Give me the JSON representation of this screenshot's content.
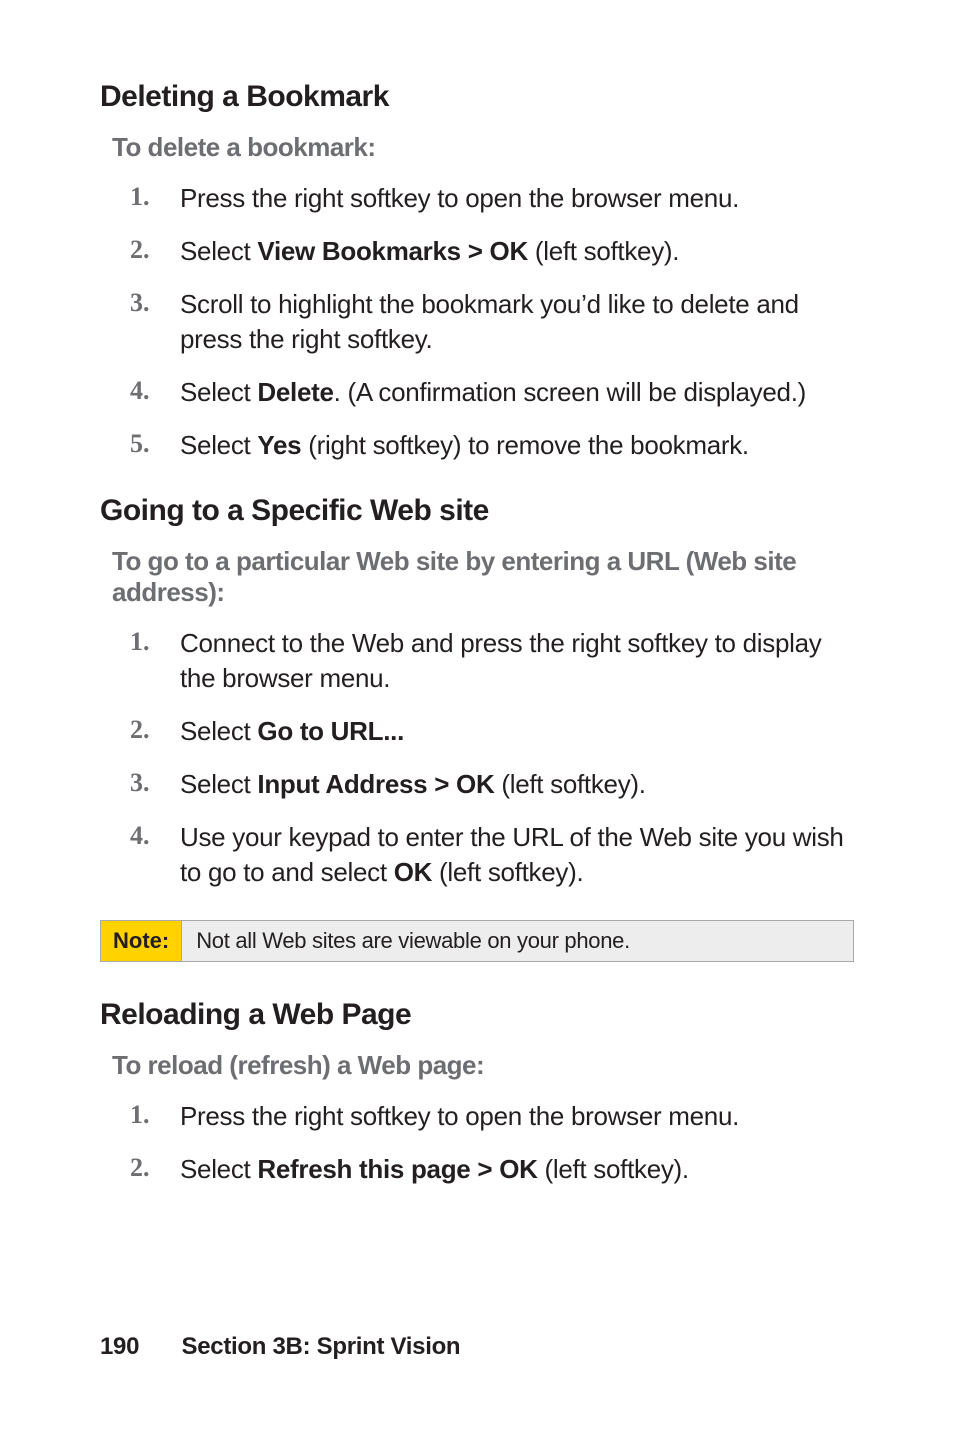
{
  "sections": [
    {
      "heading": "Deleting a Bookmark",
      "lead": "To delete a bookmark:",
      "steps": [
        {
          "n": "1.",
          "html": "Press the right softkey to open the browser menu."
        },
        {
          "n": "2.",
          "html": "Select <b>View Bookmarks > OK</b> (left softkey)."
        },
        {
          "n": "3.",
          "html": "Scroll to highlight the bookmark you’d like to delete and press the right softkey."
        },
        {
          "n": "4.",
          "html": "Select <b>Delete</b>. (A confirmation screen will be displayed.)"
        },
        {
          "n": "5.",
          "html": "Select <b>Yes</b> (right softkey) to remove the bookmark."
        }
      ]
    },
    {
      "heading": "Going to a Specific Web site",
      "lead": "To go to a particular Web site by entering a URL (Web site address):",
      "steps": [
        {
          "n": "1.",
          "html": "Connect to the Web and press the right softkey to display the browser menu."
        },
        {
          "n": "2.",
          "html": "Select <b>Go to URL...</b>"
        },
        {
          "n": "3.",
          "html": "Select <b>Input Address > OK</b> (left softkey)."
        },
        {
          "n": "4.",
          "html": "Use your keypad to enter the URL of the Web site you wish to go to and select <b>OK</b> (left softkey)."
        }
      ],
      "note": {
        "label": "Note:",
        "text": "Not all Web sites are viewable on your phone."
      }
    },
    {
      "heading": "Reloading a Web Page",
      "lead": "To reload (refresh) a Web page:",
      "steps": [
        {
          "n": "1.",
          "html": "Press the right softkey to open the browser menu."
        },
        {
          "n": "2.",
          "html": "Select <b>Refresh this page > OK</b> (left softkey)."
        }
      ]
    }
  ],
  "footer": {
    "page": "190",
    "section": "Section 3B: Sprint Vision"
  }
}
